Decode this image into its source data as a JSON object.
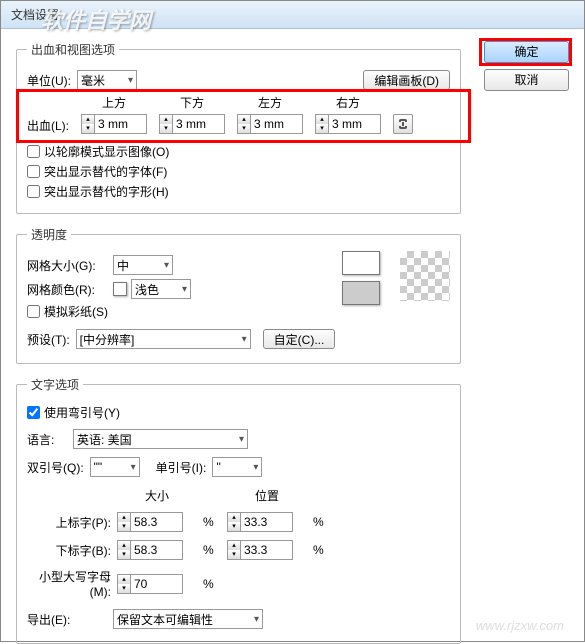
{
  "window": {
    "title": "文档设置"
  },
  "watermark": {
    "top": "软件自学网",
    "bottom": "www.rjzxw.com"
  },
  "buttons": {
    "ok": "确定",
    "cancel": "取消"
  },
  "bleed_section": {
    "legend": "出血和视图选项",
    "units_label": "单位(U):",
    "units_value": "毫米",
    "edit_artboards": "编辑画板(D)",
    "bleed_label": "出血(L):",
    "top_label": "上方",
    "bottom_label": "下方",
    "left_label": "左方",
    "right_label": "右方",
    "top_val": "3 mm",
    "bottom_val": "3 mm",
    "left_val": "3 mm",
    "right_val": "3 mm",
    "outline_mode": "以轮廓模式显示图像(O)",
    "highlight_fonts": "突出显示替代的字体(F)",
    "highlight_glyphs": "突出显示替代的字形(H)"
  },
  "transparency": {
    "legend": "透明度",
    "grid_size_label": "网格大小(G):",
    "grid_size_value": "中",
    "grid_color_label": "网格颜色(R):",
    "grid_color_value": "浅色",
    "simulate_paper": "模拟彩纸(S)",
    "preset_label": "预设(T):",
    "preset_value": "[中分辨率]",
    "custom_btn": "自定(C)...",
    "swatch_light": "#ffffff",
    "swatch_dark": "#cccccc"
  },
  "text_options": {
    "legend": "文字选项",
    "use_quotes": "使用弯引号(Y)",
    "use_quotes_checked": true,
    "language_label": "语言:",
    "language_value": "英语: 美国",
    "dquote_label": "双引号(Q):",
    "dquote_value": "\"\"",
    "squote_label": "单引号(I):",
    "squote_value": "''",
    "size_header": "大小",
    "position_header": "位置",
    "superscript_label": "上标字(P):",
    "superscript_size": "58.3",
    "superscript_pos": "33.3",
    "subscript_label": "下标字(B):",
    "subscript_size": "58.3",
    "subscript_pos": "33.3",
    "smallcaps_label": "小型大写字母(M):",
    "smallcaps_size": "70",
    "export_label": "导出(E):",
    "export_value": "保留文本可编辑性",
    "percent": "%"
  }
}
